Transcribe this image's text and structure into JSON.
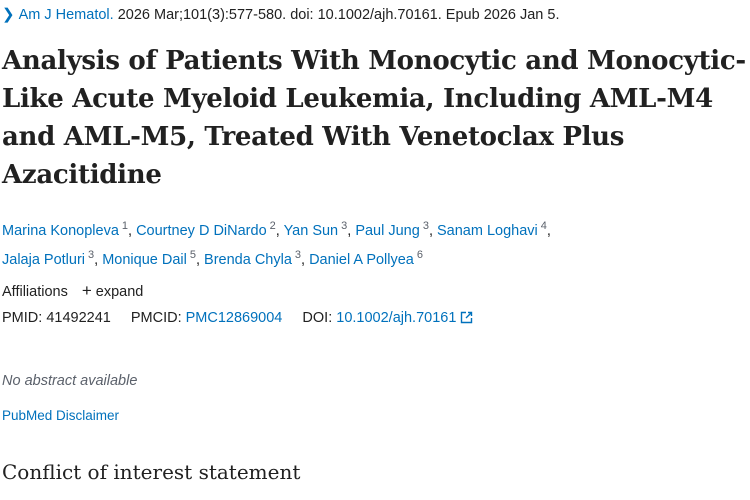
{
  "citation": {
    "journal": "Am J Hematol.",
    "details": "2026 Mar;101(3):577-580. doi: 10.1002/ajh.70161. Epub 2026 Jan 5."
  },
  "title": "Analysis of Patients With Monocytic and Monocytic-Like Acute Myeloid Leukemia, Including AML-M4 and AML-M5, Treated With Venetoclax Plus Azacitidine",
  "authors": [
    {
      "name": "Marina Konopleva",
      "aff": "1"
    },
    {
      "name": "Courtney D DiNardo",
      "aff": "2"
    },
    {
      "name": "Yan Sun",
      "aff": "3"
    },
    {
      "name": "Paul Jung",
      "aff": "3"
    },
    {
      "name": "Sanam Loghavi",
      "aff": "4"
    },
    {
      "name": "Jalaja Potluri",
      "aff": "3"
    },
    {
      "name": "Monique Dail",
      "aff": "5"
    },
    {
      "name": "Brenda Chyla",
      "aff": "3"
    },
    {
      "name": "Daniel A Pollyea",
      "aff": "6"
    }
  ],
  "affiliations": {
    "label": "Affiliations",
    "toggle": "expand"
  },
  "identifiers": {
    "pmid_label": "PMID:",
    "pmid": "41492241",
    "pmcid_label": "PMCID:",
    "pmcid": "PMC12869004",
    "doi_label": "DOI:",
    "doi": "10.1002/ajh.70161"
  },
  "no_abstract": "No abstract available",
  "disclaimer": "PubMed Disclaimer",
  "coi_heading": "Conflict of interest statement",
  "colors": {
    "link": "#0071bc",
    "text": "#212121",
    "muted": "#5b616b"
  },
  "icons": {
    "chevron": "chevron-right-icon",
    "plus": "plus-icon",
    "external": "external-link-icon"
  }
}
